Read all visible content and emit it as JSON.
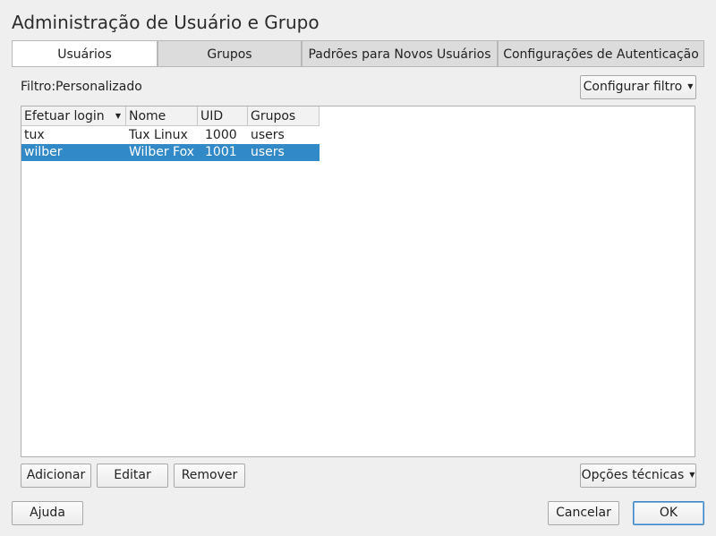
{
  "window": {
    "title": "Administração de Usuário e Grupo"
  },
  "tabs": [
    {
      "label": "Usuários",
      "active": true
    },
    {
      "label": "Grupos",
      "active": false
    },
    {
      "label": "Padrões para Novos Usuários",
      "active": false
    },
    {
      "label": "Configurações de Autenticação",
      "active": false
    }
  ],
  "filter": {
    "label": "Filtro:Personalizado",
    "button": "Configurar filtro"
  },
  "table": {
    "columns": [
      "Efetuar login",
      "Nome",
      "UID",
      "Grupos"
    ],
    "rows": [
      {
        "login": "tux",
        "name": "Tux Linux",
        "uid": "1000",
        "groups": "users",
        "selected": false
      },
      {
        "login": "wilber",
        "name": "Wilber Fox",
        "uid": "1001",
        "groups": "users",
        "selected": true
      }
    ]
  },
  "actions": {
    "add": "Adicionar",
    "edit": "Editar",
    "remove": "Remover",
    "expert": "Opções técnicas"
  },
  "footer": {
    "help": "Ajuda",
    "cancel": "Cancelar",
    "ok": "OK"
  },
  "colors": {
    "selection": "#3289c8",
    "tab_active": "#ffffff",
    "window_bg": "#efefef"
  }
}
